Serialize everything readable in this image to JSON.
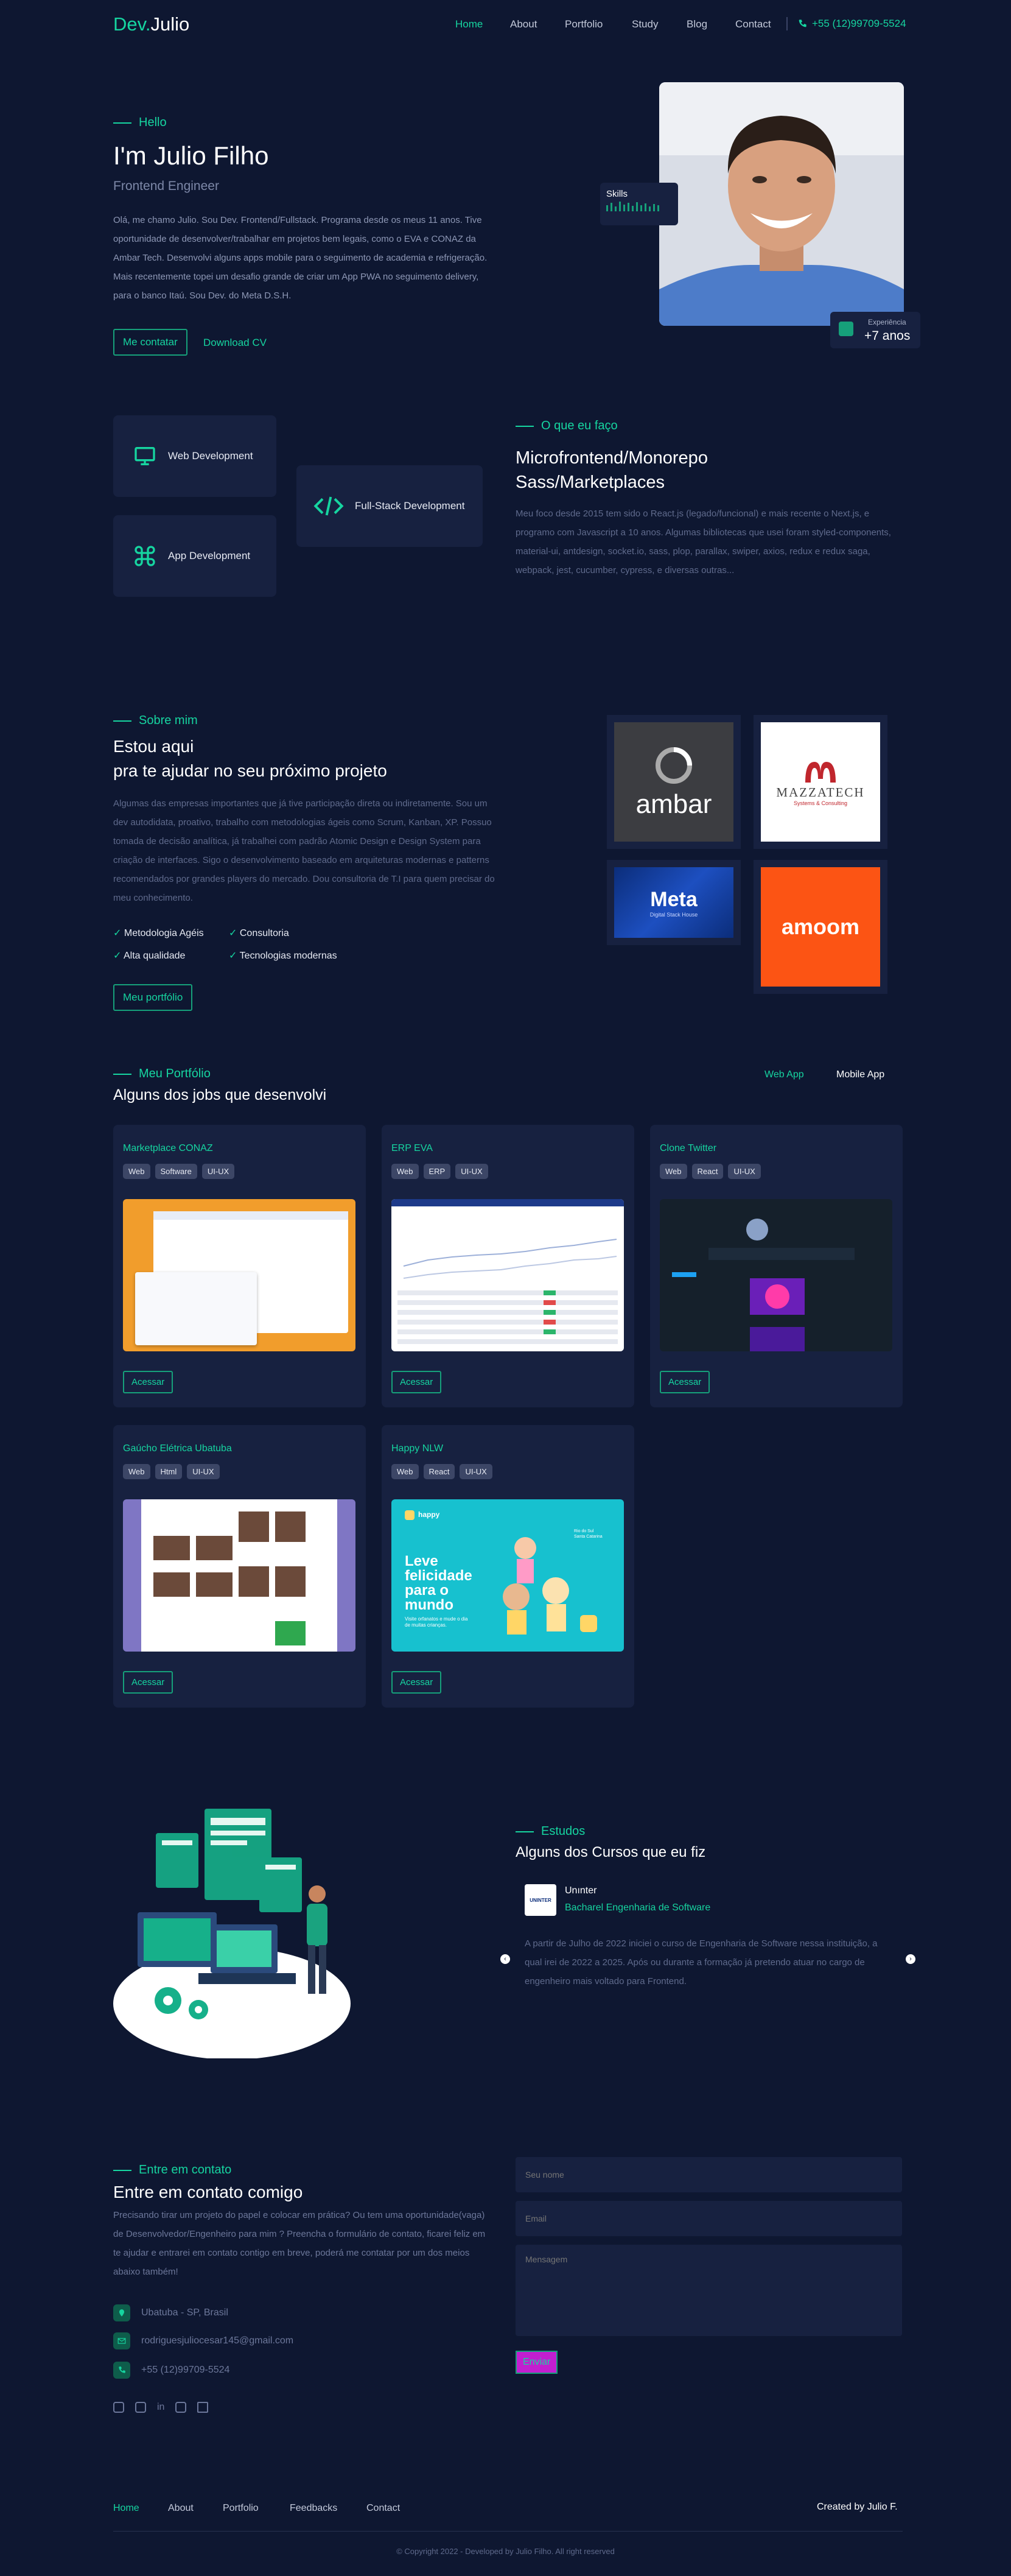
{
  "brand": {
    "prefix": "Dev.",
    "name": "Julio"
  },
  "nav": {
    "items": [
      "Home",
      "About",
      "Portfolio",
      "Study",
      "Blog",
      "Contact"
    ],
    "phone": "+55 (12)99709-5524"
  },
  "hero": {
    "kicker": "Hello",
    "title": "I'm Julio Filho",
    "subtitle": "Frontend Engineer",
    "paragraph": "Olá, me chamo Julio. Sou Dev. Frontend/Fullstack. Programa desde os meus 11 anos. Tive oportunidade de desenvolver/trabalhar em projetos bem legais, como o EVA e CONAZ da Ambar Tech. Desenvolvi alguns apps mobile para o seguimento de academia e refrigeração. Mais recentemente topei um desafio grande de criar um App PWA no seguimento delivery, para o banco Itaú. Sou Dev. do Meta D.S.H.",
    "contact_button": "Me contatar",
    "cv_button": "Download CV",
    "skills_label": "Skills",
    "experience_label": "Experiência",
    "experience_value": "+7 anos"
  },
  "services": {
    "cards": [
      "Web Development",
      "App Development",
      "Full-Stack Development"
    ],
    "kicker": "O que eu faço",
    "title_line1": "Microfrontend/Monorepo",
    "title_line2": "Sass/Marketplaces",
    "paragraph": "Meu foco desde 2015 tem sido o React.js (legado/funcional) e mais recente o Next.js, e programo com Javascript a 10 anos. Algumas bibliotecas que usei foram styled-components, material-ui, antdesign, socket.io, sass, plop, parallax, swiper, axios, redux e redux saga, webpack, jest, cucumber, cypress, e diversas outras..."
  },
  "about": {
    "kicker": "Sobre mim",
    "title_line1": "Estou aqui",
    "title_line2": "pra te ajudar no seu próximo projeto",
    "paragraph": "Algumas das empresas importantes que já tive participação direta ou indiretamente. Sou um dev autodidata, proativo, trabalho com metodologias ágeis como Scrum, Kanban, XP. Possuo tomada de decisão analítica, já trabalhei com padrão Atomic Design e Design System para criação de interfaces. Sigo o desenvolvimento baseado em arquiteturas modernas e patterns recomendados por grandes players do mercado. Dou consultoria de T.I para quem precisar do meu conhecimento.",
    "features": [
      "Metodologia Agéis",
      "Consultoria",
      "Alta qualidade",
      "Tecnologias modernas"
    ],
    "button": "Meu portfólio",
    "logos": [
      "ambar",
      "MAZZATECH",
      "Meta",
      "amoom"
    ],
    "mazzatech_sub": "Systems & Consulting",
    "meta_sub": "Digital Stack House"
  },
  "portfolio": {
    "kicker": "Meu Portfólio",
    "title": "Alguns dos jobs que desenvolvi",
    "tabs": [
      "Web App",
      "Mobile App"
    ],
    "access_label": "Acessar",
    "projects": [
      {
        "title": "Marketplace CONAZ",
        "tags": [
          "Web",
          "Software",
          "UI-UX"
        ]
      },
      {
        "title": "ERP EVA",
        "tags": [
          "Web",
          "ERP",
          "UI-UX"
        ]
      },
      {
        "title": "Clone Twitter",
        "tags": [
          "Web",
          "React",
          "UI-UX"
        ]
      },
      {
        "title": "Gaúcho Elétrica Ubatuba",
        "tags": [
          "Web",
          "Html",
          "UI-UX"
        ]
      },
      {
        "title": "Happy NLW",
        "tags": [
          "Web",
          "React",
          "UI-UX"
        ]
      }
    ],
    "happy": {
      "logo": "happy",
      "headline": "Leve felicidade para o mundo",
      "sub": "Visite orfanatos e mude o dia de muitas crianças.",
      "city": "Rio do Sul",
      "state": "Santa Catarina"
    }
  },
  "study": {
    "kicker": "Estudos",
    "title": "Alguns dos Cursos que eu fiz",
    "school": "Unınter",
    "course": "Bacharel Engenharia de Software",
    "paragraph": "A partir de Julho de 2022 iniciei o curso de Engenharia de Software nessa instituição, a qual irei de 2022 a 2025. Após ou durante a formação já pretendo atuar no cargo de engenheiro mais voltado para Frontend.",
    "logo_text": "UNINTER"
  },
  "contact": {
    "kicker": "Entre em contato",
    "title": "Entre em contato comigo",
    "paragraph": "Precisando tirar um projeto do papel e colocar em prática? Ou tem uma oportunidade(vaga) de Desenvolvedor/Engenheiro para mim ? Preencha o formulário de contato, ficarei feliz em te ajudar e entrarei em contato contigo em breve, poderá me contatar por um dos meios abaixo também!",
    "location": "Ubatuba - SP, Brasil",
    "email": "rodriguesjuliocesar145@gmail.com",
    "phone": "+55 (12)99709-5524",
    "form": {
      "name_placeholder": "Seu nome",
      "email_placeholder": "Email",
      "message_placeholder": "Mensagem",
      "submit": "Enviar"
    }
  },
  "footer": {
    "links": [
      "Home",
      "About",
      "Portfolio",
      "Feedbacks",
      "Contact"
    ],
    "credit": "Created by Julio F.",
    "copyright": "© Copyright 2022 - Developed by Julio Filho. All right reserved"
  },
  "colors": {
    "background": "#0e1731",
    "card": "#172140",
    "accent": "#16d5a0",
    "submit": "#c21fd0"
  }
}
